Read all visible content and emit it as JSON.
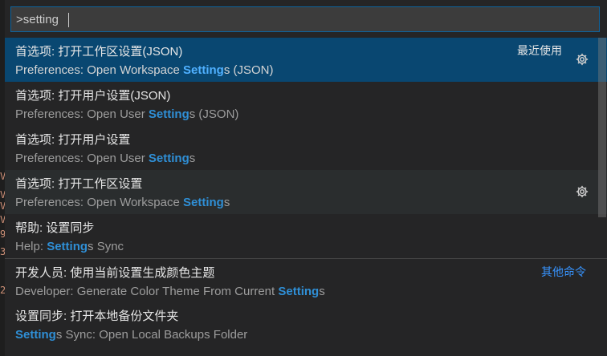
{
  "editor": {
    "gutter_chars": [
      "V",
      "V",
      "V",
      "V",
      "9",
      "3",
      "2"
    ]
  },
  "palette": {
    "input_value": ">setting",
    "items": [
      {
        "title": "首选项: 打开工作区设置(JSON)",
        "sub_pre": "Preferences: Open Workspace ",
        "sub_hl": "Setting",
        "sub_post": "s (JSON)",
        "badge": "最近使用",
        "gear_icon": "gear-icon",
        "state": "focused"
      },
      {
        "title": "首选项: 打开用户设置(JSON)",
        "sub_pre": "Preferences: Open User ",
        "sub_hl": "Setting",
        "sub_post": "s (JSON)"
      },
      {
        "title": "首选项: 打开用户设置",
        "sub_pre": "Preferences: Open User ",
        "sub_hl": "Setting",
        "sub_post": "s"
      },
      {
        "title": "首选项: 打开工作区设置",
        "sub_pre": "Preferences: Open Workspace ",
        "sub_hl": "Setting",
        "sub_post": "s",
        "gear_icon": "gear-icon",
        "state": "hovered"
      },
      {
        "title": "帮助: 设置同步",
        "sub_pre": "Help: ",
        "sub_hl": "Setting",
        "sub_post": "s Sync"
      },
      {
        "title": "开发人员: 使用当前设置生成颜色主题",
        "sub_pre": "Developer: Generate Color Theme From Current ",
        "sub_hl": "Setting",
        "sub_post": "s",
        "badge": "其他命令",
        "badge_style": "link",
        "separator": true
      },
      {
        "title": "设置同步: 打开本地备份文件夹",
        "sub_pre": "",
        "sub_hl": "Setting",
        "sub_post": "s Sync: Open Local Backups Folder"
      }
    ]
  },
  "colors": {
    "background": "#252526",
    "focused_row": "#094771",
    "highlight": "#2f8fd6",
    "link": "#3794ff",
    "input_border": "#0e639c"
  }
}
